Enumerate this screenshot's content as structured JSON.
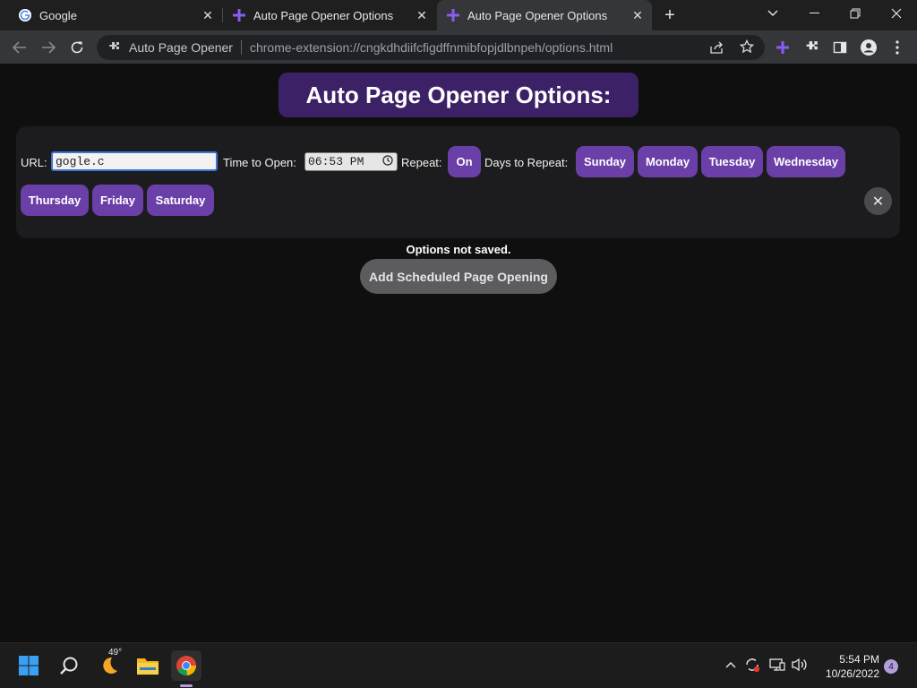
{
  "browser": {
    "tabs": [
      {
        "title": "Google",
        "favicon": "google-g-icon",
        "active": false
      },
      {
        "title": "Auto Page Opener Options",
        "favicon": "purple-plus-icon",
        "active": false
      },
      {
        "title": "Auto Page Opener Options",
        "favicon": "purple-plus-icon",
        "active": true
      }
    ],
    "tab_close_glyph": "✕",
    "newtab_glyph": "+",
    "omnibox": {
      "site_name": "Auto Page Opener",
      "url": "chrome-extension://cngkdhdiifcfigdffnmibfopjdlbnpeh/options.html"
    }
  },
  "page": {
    "header": "Auto Page Opener Options:",
    "form": {
      "url_label": "URL:",
      "url_value": "gogle.c",
      "time_label": "Time to Open:",
      "time_value": "06:53 PM",
      "repeat_label": "Repeat:",
      "repeat_button": "On",
      "days_label": "Days to Repeat:",
      "days": [
        "Sunday",
        "Monday",
        "Tuesday",
        "Wednesday",
        "Thursday",
        "Friday",
        "Saturday"
      ],
      "remove_glyph": "✕"
    },
    "status": "Options not saved.",
    "add_button": "Add Scheduled Page Opening"
  },
  "taskbar": {
    "weather_temp": "49°",
    "clock_time": "5:54 PM",
    "clock_date": "10/26/2022",
    "notification_count": "4"
  },
  "colors": {
    "accent_purple": "#6b3fa8",
    "header_purple": "#3c2167",
    "page_bg": "#0f0f10",
    "panel_bg": "#1c1c1e"
  }
}
